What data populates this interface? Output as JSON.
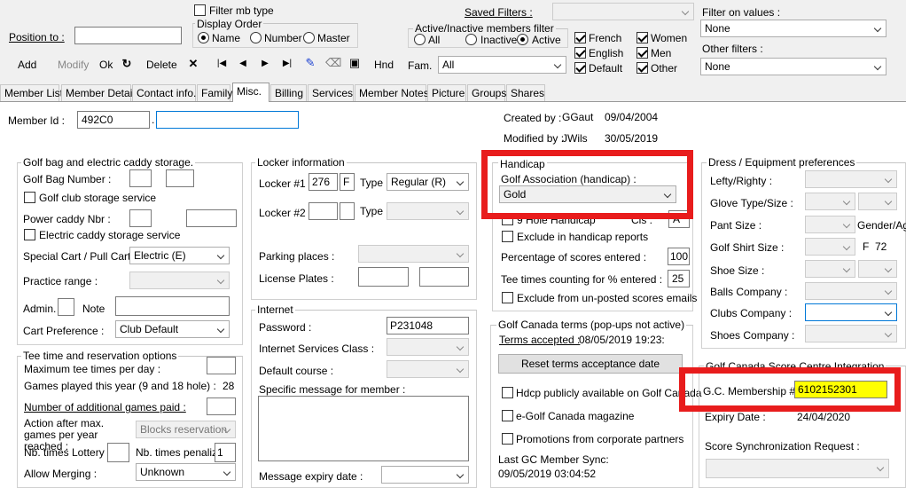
{
  "toolbar": {
    "filter_mb_type": "Filter mb type",
    "display_order": "Display Order",
    "position_to": "Position to :",
    "order_name": "Name",
    "order_number": "Number",
    "order_master": "Master",
    "saved_filters": "Saved Filters :",
    "active_filter_title": "Active/Inactive members filter",
    "opt_all": "All",
    "opt_inactive": "Inactive",
    "opt_active": "Active",
    "filter_on_values": "Filter on values :",
    "filter_value": "None",
    "other_filters": "Other filters :",
    "other_value": "None",
    "add": "Add",
    "modify": "Modify",
    "ok": "Ok",
    "delete": "Delete",
    "hnd": "Hnd",
    "fam": "Fam.",
    "fam_value": "All",
    "lang_french": "French",
    "lang_english": "English",
    "lang_default": "Default",
    "sex_women": "Women",
    "sex_men": "Men",
    "sex_other": "Other"
  },
  "tabs": [
    "Member List",
    "Member Detail",
    "Contact info.",
    "Family",
    "Misc.",
    "Billing",
    "Services",
    "Member Notes",
    "Picture",
    "Groups",
    "Shares"
  ],
  "member": {
    "id_label": "Member Id :",
    "id_value": "492C0",
    "created_by_label": "Created by :",
    "created_by": "GGaut",
    "created_date": "09/04/2004",
    "modified_by_label": "Modified by :",
    "modified_by": "JWils",
    "modified_date": "30/05/2019"
  },
  "golfbag": {
    "title": "Golf bag and electric caddy storage.",
    "bag_number": "Golf Bag Number :",
    "club_storage": "Golf club storage service",
    "power_caddy": "Power caddy Nbr :",
    "electric_storage": "Electric caddy storage service",
    "special_cart": "Special Cart / Pull Cart :",
    "special_cart_value": "Electric (E)",
    "practice": "Practice range :",
    "admin": "Admin. :",
    "note": "Note",
    "cart_pref": "Cart Preference :",
    "cart_pref_value": "Club Default"
  },
  "teetime": {
    "title": "Tee time and reservation options",
    "max_tee": "Maximum tee times per day :",
    "games_played": "Games played this year (9 and 18 hole) :",
    "games_played_value": "28",
    "additional": "Number of additional games paid :",
    "action_after": "Action after max. games per year reached :",
    "action_value": "Blocks reservation",
    "lottery": "Nb. times Lottery :",
    "penalize": "Nb. times penalize",
    "penalize_value": "1",
    "merging": "Allow Merging :",
    "merging_value": "Unknown"
  },
  "locker": {
    "title": "Locker information",
    "locker1": "Locker #1",
    "locker1_value": "276",
    "locker1_f": "F",
    "type": "Type",
    "type1_value": "Regular (R)",
    "locker2": "Locker #2 :",
    "type2": "Type",
    "parking": "Parking places :",
    "plates": "License Plates :"
  },
  "internet": {
    "title": "Internet",
    "password": "Password :",
    "password_value": "P231048",
    "class": "Internet Services Class :",
    "default_course": "Default course :",
    "specific_msg": "Specific message for member :",
    "msg_expiry": "Message expiry date :"
  },
  "handicap": {
    "title": "Handicap",
    "association": "Golf Association (handicap) :",
    "association_value": "Gold",
    "hole_handicap": "9 Hole Handicap",
    "cls": "Cls :",
    "cls_value": "A",
    "exclude_reports": "Exclude in handicap reports",
    "pct_scores": "Percentage of scores entered :",
    "pct_value": "100",
    "tee_times": "Tee times counting for % entered :",
    "tee_value": "25",
    "exclude_unposted": "Exclude from un-posted scores emails"
  },
  "gc_terms": {
    "title": "Golf Canada terms (pop-ups not active)",
    "accepted_label": "Terms accepted :",
    "accepted_value": "08/05/2019 19:23:",
    "reset_button": "Reset terms acceptance date",
    "hdcp_public": "Hdcp publicly available on Golf Canada",
    "emag": "e-Golf Canada magazine",
    "promotions": "Promotions from corporate partners",
    "last_sync_label": "Last GC Member Sync:",
    "last_sync_value": "09/05/2019 03:04:52"
  },
  "dress": {
    "title": "Dress / Equipment preferences",
    "lefty": "Lefty/Righty :",
    "glove": "Glove Type/Size :",
    "pant": "Pant Size :",
    "gender": "Gender/Ag",
    "shirt": "Golf Shirt Size :",
    "shirt_f": "F",
    "shirt_age": "72",
    "shoe": "Shoe Size :",
    "balls": "Balls Company :",
    "clubs": "Clubs Company :",
    "shoes_co": "Shoes Company :"
  },
  "gcscore": {
    "title": "Golf Canada Score Centre Integration",
    "membership_label": "G.C. Membership # :",
    "membership_value": "6102152301",
    "expiry_label": "Expiry Date :",
    "expiry_value": "24/04/2020",
    "sync_label": "Score Synchronization Request :"
  },
  "colors": {
    "highlight_red": "#e81c1c",
    "membership_bg": "#ffff00",
    "accent_blue": "#0078d7"
  }
}
